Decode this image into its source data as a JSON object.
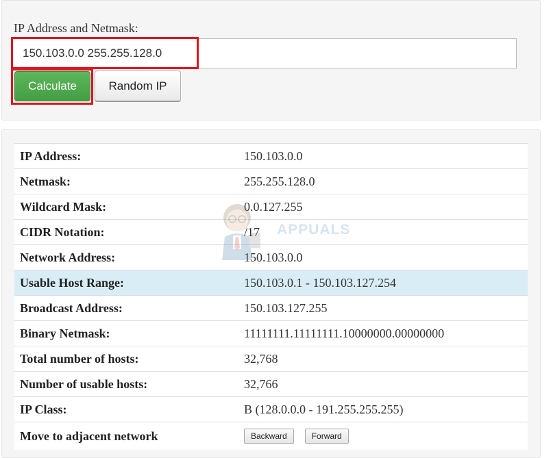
{
  "form": {
    "label": "IP Address and Netmask:",
    "input_value": "150.103.0.0 255.255.128.0",
    "calculate_label": "Calculate",
    "random_label": "Random IP"
  },
  "results": [
    {
      "key": "IP Address:",
      "value": "150.103.0.0"
    },
    {
      "key": "Netmask:",
      "value": "255.255.128.0"
    },
    {
      "key": "Wildcard Mask:",
      "value": "0.0.127.255"
    },
    {
      "key": "CIDR Notation:",
      "value": "/17"
    },
    {
      "key": "Network Address:",
      "value": "150.103.0.0"
    },
    {
      "key": "Usable Host Range:",
      "value": "150.103.0.1 - 150.103.127.254"
    },
    {
      "key": "Broadcast Address:",
      "value": "150.103.127.255"
    },
    {
      "key": "Binary Netmask:",
      "value": "11111111.11111111.10000000.00000000"
    },
    {
      "key": "Total number of hosts:",
      "value": "32,768"
    },
    {
      "key": "Number of usable hosts:",
      "value": "32,766"
    },
    {
      "key": "IP Class:",
      "value": "B (128.0.0.0 - 191.255.255.255)"
    },
    {
      "key": "Move to adjacent network",
      "backward_label": "Backward",
      "forward_label": "Forward"
    }
  ],
  "watermark": {
    "text": "APPUALS"
  },
  "colors": {
    "calculate_button": "#5cb85c",
    "highlight_row": "#d9edf7",
    "annotation_red": "#e0141e"
  }
}
